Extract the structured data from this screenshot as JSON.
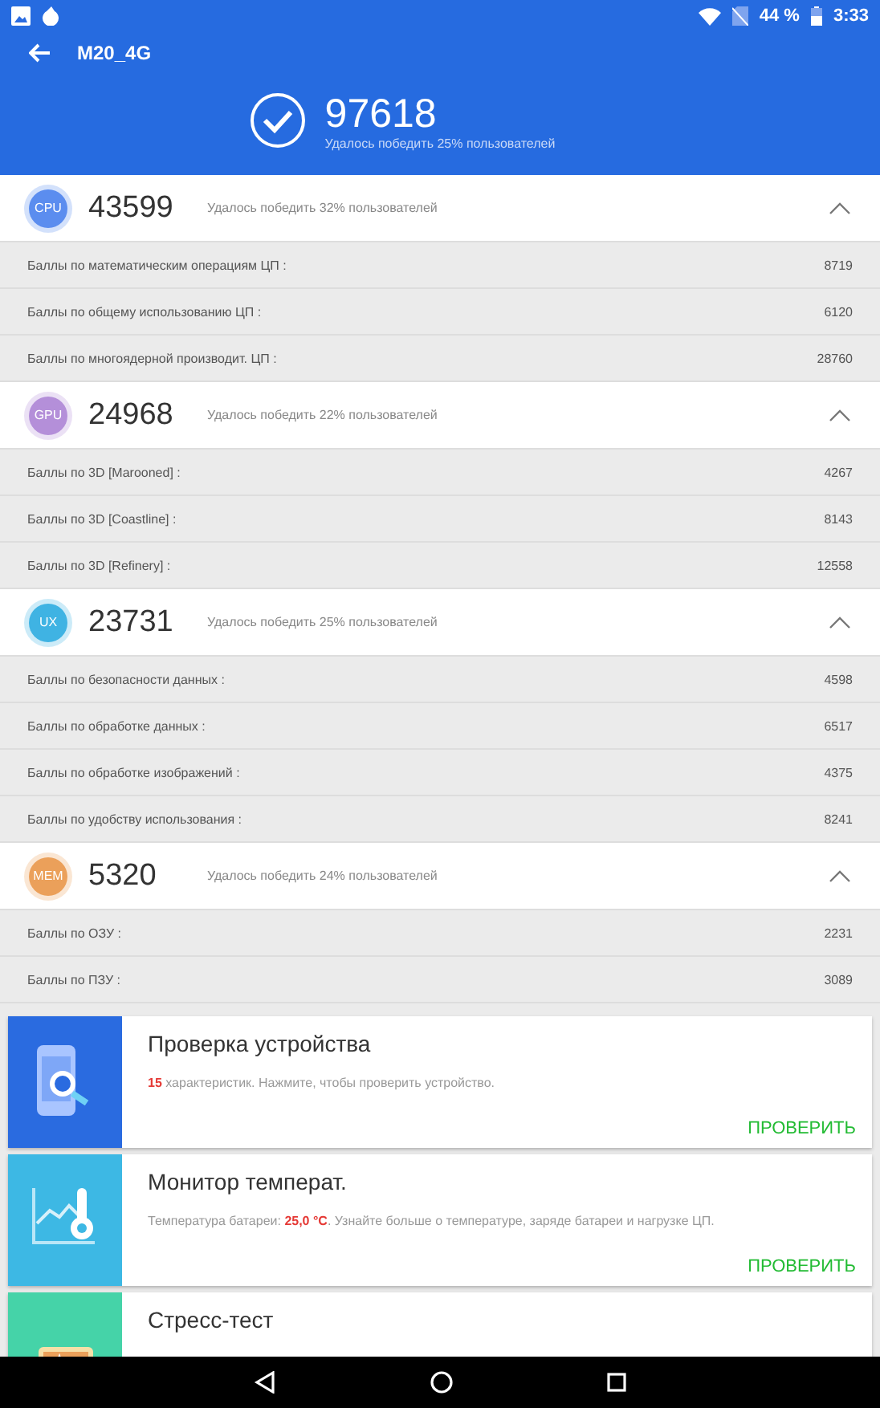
{
  "status_bar": {
    "battery": "44 %",
    "time": "3:33"
  },
  "app_bar": {
    "title": "M20_4G"
  },
  "total": {
    "score": "97618",
    "subtitle": "Удалось победить 25% пользователей"
  },
  "sections": [
    {
      "badge": "CPU",
      "color": "#5b8def",
      "score": "43599",
      "subtitle": "Удалось победить 32% пользователей",
      "expanded": true,
      "rows": [
        {
          "label": "Баллы по математическим операциям ЦП :",
          "value": "8719"
        },
        {
          "label": "Баллы по общему использованию ЦП :",
          "value": "6120"
        },
        {
          "label": "Баллы по многоядерной производит. ЦП :",
          "value": "28760"
        }
      ]
    },
    {
      "badge": "GPU",
      "color": "#b48fd9",
      "score": "24968",
      "subtitle": "Удалось победить 22% пользователей",
      "expanded": true,
      "rows": [
        {
          "label": "Баллы по 3D [Marooned] :",
          "value": "4267"
        },
        {
          "label": "Баллы по 3D [Coastline] :",
          "value": "8143"
        },
        {
          "label": "Баллы по 3D [Refinery] :",
          "value": "12558"
        }
      ]
    },
    {
      "badge": "UX",
      "color": "#3fb3e3",
      "score": "23731",
      "subtitle": "Удалось победить 25% пользователей",
      "expanded": true,
      "rows": [
        {
          "label": "Баллы по безопасности данных :",
          "value": "4598"
        },
        {
          "label": "Баллы по обработке данных :",
          "value": "6517"
        },
        {
          "label": "Баллы по обработке изображений :",
          "value": "4375"
        },
        {
          "label": "Баллы по удобству использования :",
          "value": "8241"
        }
      ]
    },
    {
      "badge": "MEM",
      "color": "#eba05a",
      "score": "5320",
      "subtitle": "Удалось победить 24% пользователей",
      "expanded": true,
      "rows": [
        {
          "label": "Баллы по ОЗУ :",
          "value": "2231"
        },
        {
          "label": "Баллы по ПЗУ :",
          "value": "3089"
        }
      ]
    }
  ],
  "cards": [
    {
      "kind": "device-check",
      "color": "#2a6be0",
      "title": "Проверка устройства",
      "description": [
        {
          "text": "15",
          "highlight": true
        },
        {
          "text": " характеристик. Нажмите, чтобы проверить устройство.",
          "highlight": false
        }
      ],
      "action": "ПРОВЕРИТЬ"
    },
    {
      "kind": "temperature",
      "color": "#3db8e4",
      "title": "Монитор температ.",
      "description": [
        {
          "text": "Температура батареи: ",
          "highlight": false
        },
        {
          "text": "25,0 °C",
          "highlight": true
        },
        {
          "text": ". Узнайте больше о температуре, заряде батареи и нагрузке ЦП.",
          "highlight": false
        }
      ],
      "action": "ПРОВЕРИТЬ"
    },
    {
      "kind": "stress",
      "color": "#45d3a8",
      "title": "Стресс-тест"
    }
  ]
}
